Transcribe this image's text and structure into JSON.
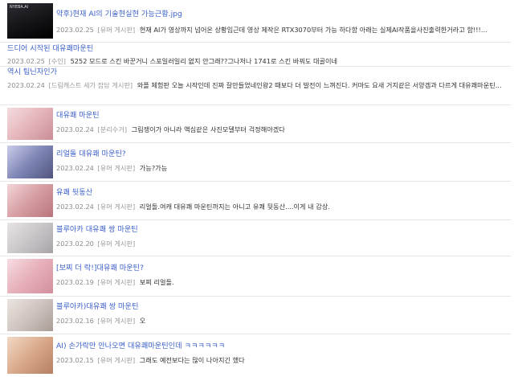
{
  "posts": [
    {
      "title": "약후)현재 AI의 기술현실현 가능근황.jpg",
      "date": "2023.02.25",
      "board": "[유머 게시판]",
      "snippet": "현재 AI가 영상까지 넘어온 상황임근데 영상 제작은 RTX3070부터 가능 하다함 아래는 실제AI작품을사진출력한거라고 함!!!...",
      "thumb_text": "NYEBA.AI",
      "thumb_colors": [
        "#1d1d1f",
        "#3a3a40",
        "#0f0f12"
      ]
    },
    {
      "title": "드디어 시작된 대유쾌마운틴",
      "date": "2023.02.25",
      "board": "[수인]",
      "snippet": "5252 모드로 스킨 바꾼거니 스포일러일리 없지 안그래??그나저나 1741로 스킨 바꿔도 대골이네",
      "thumb_text": "",
      "thumb_colors": []
    },
    {
      "title": "역시 팁닌자인가",
      "date": "2023.02.24",
      "board": "[드림캐스트 세가 잡담 게시판]",
      "snippet": "와플 체험판 오늘 시작인데 진짜 잘만들었네인왕2 때보다 더 발전이 느껴진다. 커마도 요새 거지같은 서양겜과 다르게 대유쾌마운틴...",
      "thumb_text": "",
      "thumb_colors": []
    },
    {
      "title": "대유쾌 마운틴",
      "date": "2023.02.24",
      "board": "[분리수거]",
      "snippet": "그림쟁이가 아니라 액심같은 사진모델부터 걱정해야겠다",
      "thumb_text": "",
      "thumb_colors": [
        "#e7b9be",
        "#f3dcdf",
        "#c98d97"
      ]
    },
    {
      "title": "리얼돌 대유쾌 마운틴?",
      "date": "2023.02.24",
      "board": "[유머 게시판]",
      "snippet": "가능?가능",
      "thumb_text": "",
      "thumb_colors": [
        "#7f86b6",
        "#c9cde8",
        "#4f557d"
      ]
    },
    {
      "title": "유쾌 뒷동산",
      "date": "2023.02.24",
      "board": "[유머 게시판]",
      "snippet": "리얼돌.여캐 대유쾌 마운틴까지는 아니고 유쾌 뒷동산....이게 내 감상.",
      "thumb_text": "",
      "thumb_colors": [
        "#d9a2a7",
        "#f1d6d8",
        "#b9747d"
      ]
    },
    {
      "title": "블루아카 대유쾌 쌍 마운틴",
      "date": "2023.02.20",
      "board": "[유머 게시판]",
      "snippet": "",
      "thumb_text": "",
      "thumb_colors": [
        "#c9c6c8",
        "#e8e4e6",
        "#a8a3a8"
      ]
    },
    {
      "title": "[보찌 더 락!]대유쾌 마운틴?",
      "date": "2023.02.19",
      "board": "[유머 게시판]",
      "snippet": "보찌 리얼돌.",
      "thumb_text": "",
      "thumb_colors": [
        "#e8b3bd",
        "#f6dde2",
        "#d28e9c"
      ]
    },
    {
      "title": "블루아카)대유쾌 쌍 마운틴",
      "date": "2023.02.16",
      "board": "[유머 게시판]",
      "snippet": "오",
      "thumb_text": "",
      "thumb_colors": [
        "#cfc4bf",
        "#ebe4e0",
        "#a99c97"
      ]
    },
    {
      "title": "AI) 손가락만 안나오면 대유쾌마운틴인데 ㅋㅋㅋㅋㅋㅋ",
      "date": "2023.02.15",
      "board": "[유머 게시판]",
      "snippet": "그래도 예전보다는 많이 나아지긴 했다",
      "thumb_text": "",
      "thumb_colors": [
        "#d9a989",
        "#f2d8c6",
        "#b57f63"
      ]
    }
  ]
}
